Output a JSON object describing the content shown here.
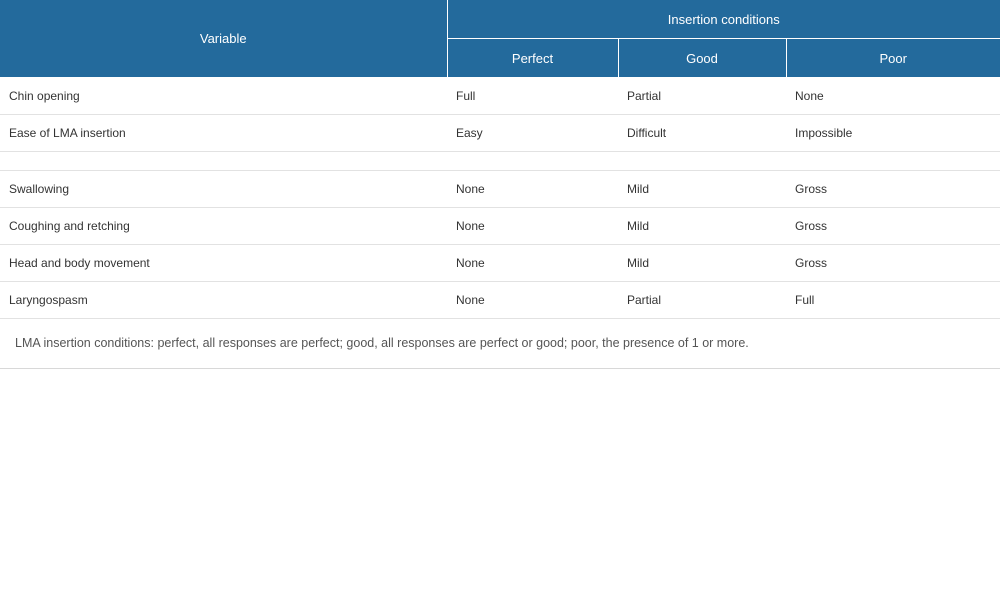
{
  "table": {
    "headers": {
      "variable": "Variable",
      "group": "Insertion conditions",
      "columns": [
        "Perfect",
        "Good",
        "Poor"
      ]
    },
    "rows": [
      {
        "variable": "Chin opening",
        "values": [
          "Full",
          "Partial",
          "None"
        ]
      },
      {
        "variable": "Ease of LMA insertion",
        "values": [
          "Easy",
          "Difficult",
          "Impossible"
        ]
      },
      {
        "variable": "",
        "values": [
          "",
          "",
          ""
        ]
      },
      {
        "variable": "Swallowing",
        "values": [
          "None",
          "Mild",
          "Gross"
        ]
      },
      {
        "variable": "Coughing and retching",
        "values": [
          "None",
          "Mild",
          "Gross"
        ]
      },
      {
        "variable": "Head and body movement",
        "values": [
          "None",
          "Mild",
          "Gross"
        ]
      },
      {
        "variable": "Laryngospasm",
        "values": [
          "None",
          "Partial",
          "Full"
        ]
      }
    ],
    "footnote": "LMA insertion conditions: perfect, all responses are perfect; good, all responses are perfect or good; poor, the presence of 1 or more."
  },
  "colors": {
    "header_bg": "#236a9c",
    "header_text": "#ffffff",
    "row_divider": "#e2e2e2"
  }
}
